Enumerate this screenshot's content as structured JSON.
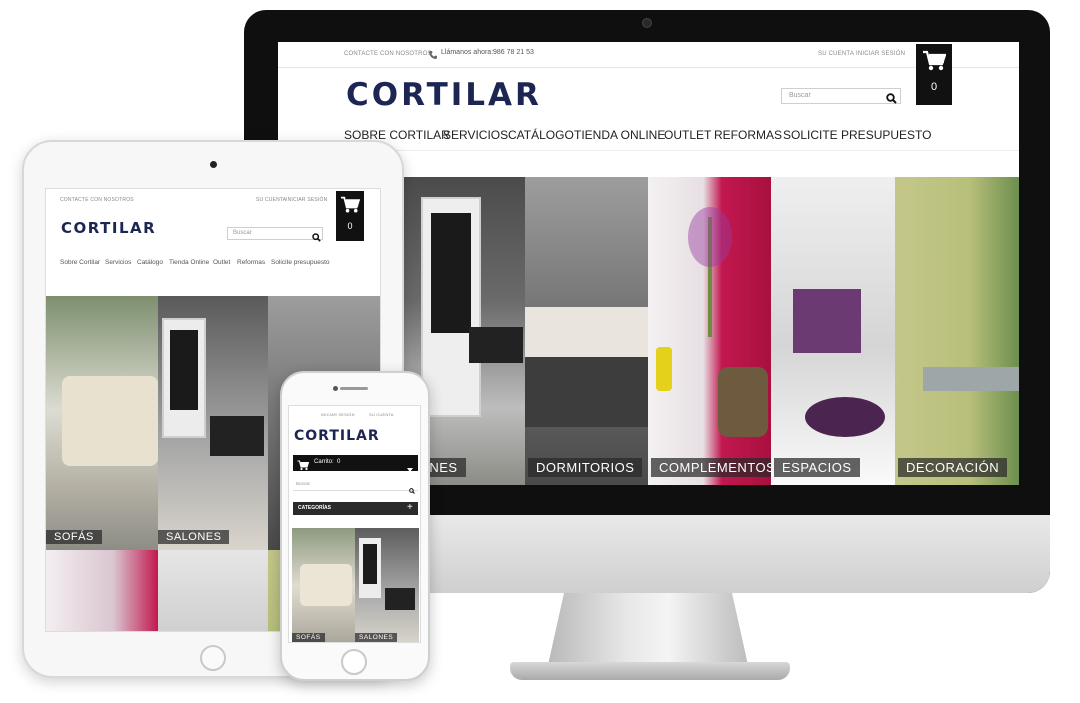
{
  "desktop": {
    "topbar": {
      "contact": "CONTACTE CON NOSOTROS",
      "phone_label": "Llámanos ahora:",
      "phone_number": "986 78 21 53",
      "account": "SU CUENTA",
      "login": "INICIAR SESIÓN"
    },
    "logo": "CORTILAR",
    "search_placeholder": "Buscar",
    "cart_count": "0",
    "nav": [
      "SOBRE CORTILAR",
      "SERVICIOS",
      "CATÁLOGO",
      "TIENDA ONLINE",
      "OUTLET",
      "REFORMAS",
      "SOLICITE PRESUPUESTO"
    ],
    "categories": [
      "LONES",
      "DORMITORIOS",
      "COMPLEMENTOS",
      "ESPACIOS",
      "DECORACIÓN"
    ]
  },
  "tablet": {
    "topbar": {
      "contact": "CONTACTE CON NOSOTROS",
      "account": "SU CUENTA",
      "login": "INICIAR SESIÓN"
    },
    "logo": "CORTILAR",
    "search_placeholder": "Buscar",
    "cart_count": "0",
    "nav": [
      "Sobre Cortilar",
      "Servicios",
      "Catálogo",
      "Tienda Online",
      "Outlet",
      "Reformas",
      "Solicite presupuesto"
    ],
    "categories": [
      "SOFÁS",
      "SALONES"
    ]
  },
  "phone": {
    "topbar": {
      "login": "INICIAR SESIÓN",
      "account": "SU CUENTA"
    },
    "logo": "CORTILAR",
    "cart_label": "Carrito:",
    "cart_count": "0",
    "search_placeholder": "Buscar",
    "categories_label": "CATEGORÍAS",
    "categories": [
      "SOFÁS",
      "SALONES"
    ]
  },
  "colors": {
    "brand_navy": "#1d2553",
    "cart_black": "#111111",
    "label_overlay": "#3a3a3a"
  },
  "icons": [
    "phone-icon",
    "search-icon",
    "cart-icon",
    "plus-icon",
    "chevron-down-icon"
  ]
}
